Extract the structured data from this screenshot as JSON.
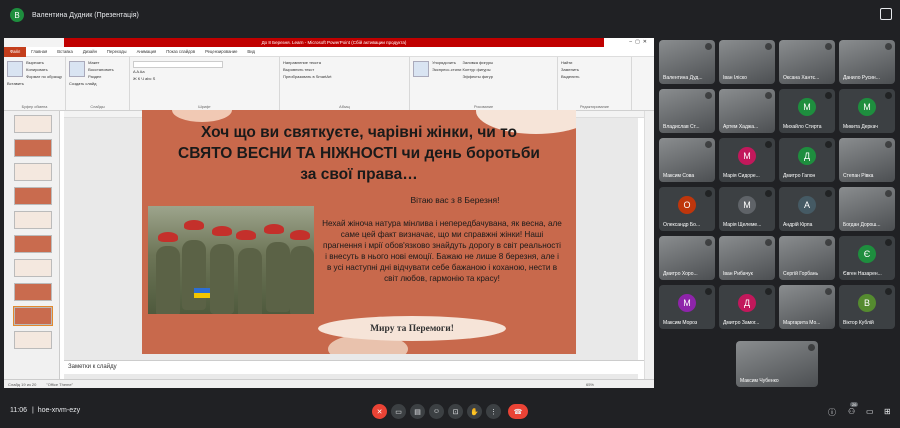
{
  "presenter": {
    "avatar_letter": "В",
    "label": "Валентина Дудник (Презентація)"
  },
  "powerpoint": {
    "window_title": "До 8 Березня. Learn - Microsoft PowerPoint (Сбій активации продукта)",
    "tabs": [
      "Файл",
      "Главная",
      "Вставка",
      "Дизайн",
      "Переходы",
      "Анимация",
      "Показ слайдов",
      "Рецензирование",
      "Вид"
    ],
    "ribbon_groups": [
      {
        "name": "Буфер обмена",
        "items": [
          "Вырезать",
          "Копировать",
          "Формат по образцу"
        ],
        "big": "Вставить"
      },
      {
        "name": "Слайды",
        "items": [
          "Макет",
          "Восстановить",
          "Раздел"
        ],
        "big": "Создать слайд"
      },
      {
        "name": "Шрифт",
        "items": [
          "A A Aa",
          "Ж К Ч abc S"
        ]
      },
      {
        "name": "Абзац",
        "items": [
          "Направление текста",
          "Выровнять текст",
          "Преобразовать в SmartArt"
        ]
      },
      {
        "name": "Рисование",
        "items": [
          "Упорядочить",
          "Экспресс-стили",
          "Заливка фигуры",
          "Контур фигуры",
          "Эффекты фигур"
        ]
      },
      {
        "name": "Редактирование",
        "items": [
          "Найти",
          "Заменить",
          "Выделить"
        ]
      }
    ],
    "notes_placeholder": "Заметки к слайду",
    "status": {
      "slide": "Слайд 19 из 20",
      "theme": "\"Office Theme\"",
      "zoom": "65%"
    }
  },
  "slide": {
    "title": "Хоч що ви святкуєте, чарівні жінки, чи то СВЯТО ВЕСНИ ТА НІЖНОСТІ чи день боротьби за свої права…",
    "greeting": "Вітаю вас з 8 Березня!",
    "body": "Нехай жіноча натура мінлива і непередбачувана, як весна, але саме цей факт визначає, що ми справжні жінки! Наші прагнення і мрії обов'язково знайдуть дорогу в світ реальності і внесуть в нього нові емоції. Бажаю не лише 8 березня, але і в усі наступні дні відчувати себе бажаною і коханою, нести в світ любов, гармонію та красу!",
    "closing": "Миру та Перемоги!"
  },
  "participants": [
    {
      "name": "Валентина Дуд...",
      "type": "video"
    },
    {
      "name": "Іван Іліско",
      "type": "video"
    },
    {
      "name": "Оксана Хантє...",
      "type": "video"
    },
    {
      "name": "Данило Русин...",
      "type": "video"
    },
    {
      "name": "Владислав Ст...",
      "type": "video"
    },
    {
      "name": "Артем Хаджа...",
      "type": "video"
    },
    {
      "name": "Михайло Стирта",
      "type": "avatar",
      "letter": "М",
      "color": "#1e8e3e"
    },
    {
      "name": "Микита Деркач",
      "type": "avatar",
      "letter": "М",
      "color": "#1e8e3e"
    },
    {
      "name": "Максим Сова",
      "type": "video"
    },
    {
      "name": "Марія Сидоре...",
      "type": "avatar",
      "letter": "М",
      "color": "#c2185b"
    },
    {
      "name": "Дмитро Гапон",
      "type": "avatar",
      "letter": "Д",
      "color": "#1e8e3e"
    },
    {
      "name": "Степан Рівка",
      "type": "video"
    },
    {
      "name": "Олександр Бо...",
      "type": "avatar",
      "letter": "О",
      "color": "#bf360c"
    },
    {
      "name": "Марія Щелеме...",
      "type": "avatar",
      "letter": "М",
      "color": "#5f6368"
    },
    {
      "name": "Андрій Кірпа",
      "type": "avatar",
      "letter": "А",
      "color": "#455a64"
    },
    {
      "name": "Богдан Дорош...",
      "type": "video"
    },
    {
      "name": "Дмитро Хоро...",
      "type": "video"
    },
    {
      "name": "Іван Рибачук",
      "type": "video"
    },
    {
      "name": "Сергій Горбань",
      "type": "video"
    },
    {
      "name": "Євген Назарен...",
      "type": "avatar",
      "letter": "Є",
      "color": "#1e8e3e"
    },
    {
      "name": "Максим Мороз",
      "type": "avatar",
      "letter": "М",
      "color": "#8e24aa"
    },
    {
      "name": "Дмитро Замог...",
      "type": "avatar",
      "letter": "Д",
      "color": "#c2185b"
    },
    {
      "name": "Маргарита Мо...",
      "type": "video"
    },
    {
      "name": "Віктор Кублій",
      "type": "avatar",
      "letter": "В",
      "color": "#558b2f"
    },
    {
      "name": "Максим Чубенко",
      "type": "video"
    }
  ],
  "bottom": {
    "time": "11:06",
    "separator": "|",
    "meeting_code": "hoe-xrvm-ezy",
    "participant_count": "26"
  }
}
